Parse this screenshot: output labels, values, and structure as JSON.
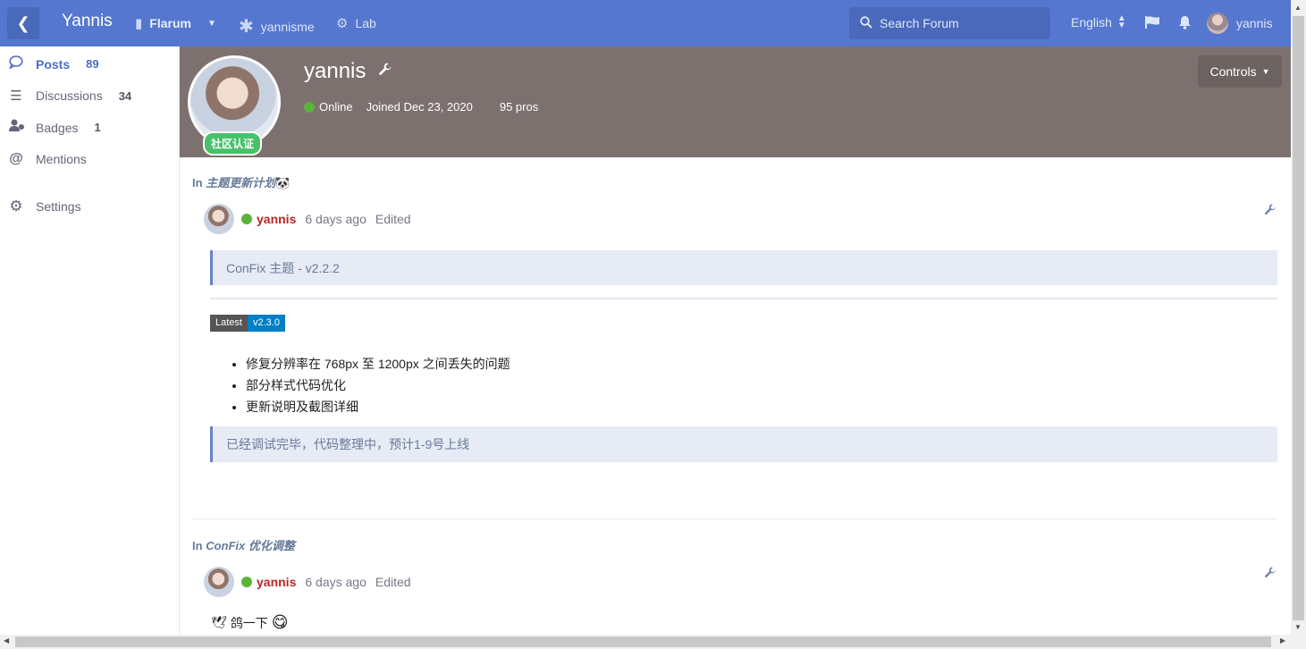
{
  "header": {
    "brand": "Yannis",
    "nav": [
      {
        "label": "Flarum",
        "icon": "comment-icon"
      },
      {
        "label": "yannisme",
        "icon": "asterisk-icon"
      },
      {
        "label": "Lab",
        "icon": "gears-icon"
      }
    ],
    "search_placeholder": "Search Forum",
    "language": "English",
    "username": "yannis"
  },
  "sidebar": {
    "items": [
      {
        "label": "Posts",
        "count": "89",
        "icon": "comment-outline-icon",
        "active": true
      },
      {
        "label": "Discussions",
        "count": "34",
        "icon": "list-icon"
      },
      {
        "label": "Badges",
        "count": "1",
        "icon": "user-badge-icon"
      },
      {
        "label": "Mentions",
        "count": "",
        "icon": "at-icon"
      },
      {
        "label": "Settings",
        "count": "",
        "icon": "gear-icon"
      }
    ]
  },
  "profile": {
    "name": "yannis",
    "badge": "社区认证",
    "status": "Online",
    "joined": "Joined Dec 23, 2020",
    "pros": "95 pros",
    "controls_label": "Controls",
    "hero_color": "#7d7170"
  },
  "posts": [
    {
      "in_label": "In",
      "discussion": "主题更新计划",
      "discussion_emoji": "🐼",
      "author": "yannis",
      "time": "6 days ago",
      "edited": "Edited",
      "quote1": "ConFix 主题 - v2.2.2",
      "shield_left": "Latest",
      "shield_right": "v2.3.0",
      "list": [
        "修复分辨率在 768px 至 1200px 之间丢失的问题",
        "部分样式代码优化",
        "更新说明及截图详细"
      ],
      "quote2": "已经调试完毕，代码整理中，预计1-9号上线"
    },
    {
      "in_label": "In",
      "discussion": "ConFix 优化调整",
      "author": "yannis",
      "time": "6 days ago",
      "edited": "Edited",
      "body_prefix_emoji": "🕊",
      "body": "鸽一下",
      "body_suffix_emoji": "😋"
    }
  ],
  "colors": {
    "header": "#5577cf",
    "accent": "#4d6bc6",
    "author": "#b62727",
    "online": "#5ab43a",
    "verify": "#47c16a"
  }
}
